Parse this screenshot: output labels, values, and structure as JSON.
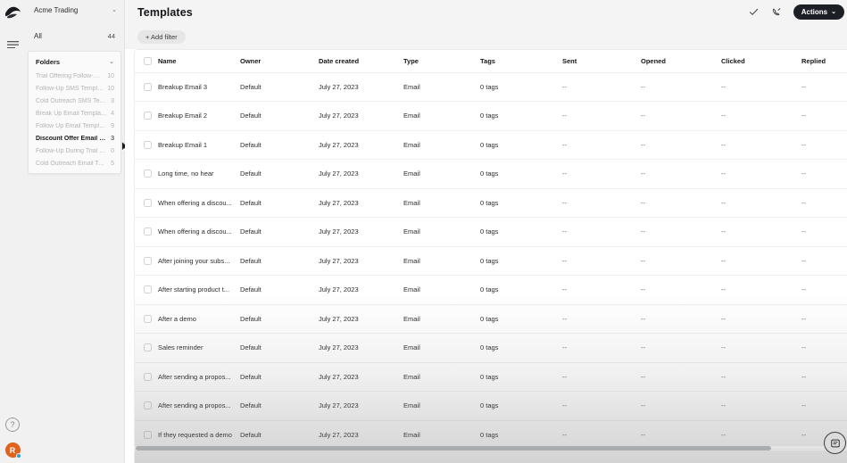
{
  "rail": {
    "logo_icon": "brand-logo-icon",
    "menu_icon": "hamburger-menu-icon",
    "help_label": "?",
    "avatar_initial": "R"
  },
  "sidebar": {
    "org": {
      "name": "Acme Trading",
      "chevron": "⌄"
    },
    "all": {
      "label": "All",
      "count": "44"
    },
    "folders_header": {
      "label": "Folders",
      "chevron": "⌄"
    },
    "folders": [
      {
        "label": "Trial Offering Follow-Up S...",
        "count": "10",
        "active": false
      },
      {
        "label": "Follow-Up SMS Templates",
        "count": "10",
        "active": false
      },
      {
        "label": "Cold Outreach SMS Templ...",
        "count": "3",
        "active": false
      },
      {
        "label": "Break Up Email Templates",
        "count": "4",
        "active": false
      },
      {
        "label": "Follow Up Email Templates",
        "count": "9",
        "active": false
      },
      {
        "label": "Discount Offer Email Temp...",
        "count": "3",
        "active": true
      },
      {
        "label": "Follow-Up During Trial Em...",
        "count": "0",
        "active": false
      },
      {
        "label": "Cold Outreach Email Templ...",
        "count": "5",
        "active": false
      }
    ]
  },
  "topbar": {
    "title": "Templates",
    "check_icon": "checkmark-icon",
    "call_icon": "phone-icon",
    "actions_label": "Actions",
    "actions_chevron": "⌄"
  },
  "filterbar": {
    "add_filter_label": "+ Add filter"
  },
  "table": {
    "columns": [
      "Name",
      "Owner",
      "Date created",
      "Type",
      "Tags",
      "Sent",
      "Opened",
      "Clicked",
      "Replied"
    ],
    "rows": [
      {
        "name": "Breakup Email 3",
        "owner": "Default",
        "date": "July 27, 2023",
        "type": "Email",
        "tags": "0 tags",
        "sent": "--",
        "opened": "--",
        "clicked": "--",
        "replied": "--"
      },
      {
        "name": "Breakup Email 2",
        "owner": "Default",
        "date": "July 27, 2023",
        "type": "Email",
        "tags": "0 tags",
        "sent": "--",
        "opened": "--",
        "clicked": "--",
        "replied": "--"
      },
      {
        "name": "Breakup Email 1",
        "owner": "Default",
        "date": "July 27, 2023",
        "type": "Email",
        "tags": "0 tags",
        "sent": "--",
        "opened": "--",
        "clicked": "--",
        "replied": "--"
      },
      {
        "name": "Long time, no hear",
        "owner": "Default",
        "date": "July 27, 2023",
        "type": "Email",
        "tags": "0 tags",
        "sent": "--",
        "opened": "--",
        "clicked": "--",
        "replied": "--"
      },
      {
        "name": "When offering a discou...",
        "owner": "Default",
        "date": "July 27, 2023",
        "type": "Email",
        "tags": "0 tags",
        "sent": "--",
        "opened": "--",
        "clicked": "--",
        "replied": "--"
      },
      {
        "name": "When offering a discou...",
        "owner": "Default",
        "date": "July 27, 2023",
        "type": "Email",
        "tags": "0 tags",
        "sent": "--",
        "opened": "--",
        "clicked": "--",
        "replied": "--"
      },
      {
        "name": "After joining your subs...",
        "owner": "Default",
        "date": "July 27, 2023",
        "type": "Email",
        "tags": "0 tags",
        "sent": "--",
        "opened": "--",
        "clicked": "--",
        "replied": "--"
      },
      {
        "name": "After starting product t...",
        "owner": "Default",
        "date": "July 27, 2023",
        "type": "Email",
        "tags": "0 tags",
        "sent": "--",
        "opened": "--",
        "clicked": "--",
        "replied": "--"
      },
      {
        "name": "After a demo",
        "owner": "Default",
        "date": "July 27, 2023",
        "type": "Email",
        "tags": "0 tags",
        "sent": "--",
        "opened": "--",
        "clicked": "--",
        "replied": "--"
      },
      {
        "name": "Sales reminder",
        "owner": "Default",
        "date": "July 27, 2023",
        "type": "Email",
        "tags": "0 tags",
        "sent": "--",
        "opened": "--",
        "clicked": "--",
        "replied": "--"
      },
      {
        "name": "After sending a propos...",
        "owner": "Default",
        "date": "July 27, 2023",
        "type": "Email",
        "tags": "0 tags",
        "sent": "--",
        "opened": "--",
        "clicked": "--",
        "replied": "--"
      },
      {
        "name": "After sending a propos...",
        "owner": "Default",
        "date": "July 27, 2023",
        "type": "Email",
        "tags": "0 tags",
        "sent": "--",
        "opened": "--",
        "clicked": "--",
        "replied": "--"
      },
      {
        "name": "If they requested a demo",
        "owner": "Default",
        "date": "July 27, 2023",
        "type": "Email",
        "tags": "0 tags",
        "sent": "--",
        "opened": "--",
        "clicked": "--",
        "replied": "--"
      }
    ]
  },
  "footer": {
    "chat_icon": "chat-message-icon"
  },
  "colors": {
    "accent_dark": "#1c1f26",
    "avatar_orange": "#e0621b",
    "status_blue": "#2a9fd6"
  }
}
